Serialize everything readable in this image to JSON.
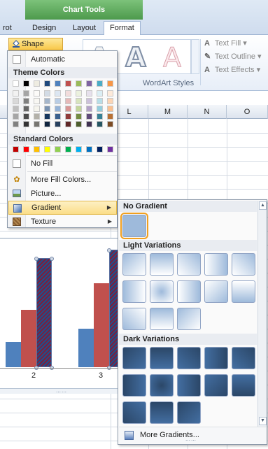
{
  "ribbon": {
    "context_title": "Chart Tools",
    "tabs": [
      "rot",
      "Design",
      "Layout",
      "Format"
    ],
    "active_tab": "Format",
    "shape_fill_label": "Shape Fill",
    "wordart_letter": "A",
    "text_fill_label": "Text Fill",
    "text_outline_label": "Text Outline",
    "text_effects_label": "Text Effects",
    "wordart_group_label": "WordArt Styles"
  },
  "grid": {
    "column_headers": [
      "L",
      "M",
      "N",
      "O"
    ]
  },
  "chart": {
    "x_labels": [
      "2",
      "3"
    ]
  },
  "chart_data": {
    "type": "bar",
    "categories": [
      "2",
      "3"
    ],
    "series": [
      {
        "color": "#4f81bd",
        "values": [
          1.5,
          2.3
        ]
      },
      {
        "color": "#c0504d",
        "values": [
          3.4,
          5.0
        ]
      },
      {
        "color": "#7a1f3d",
        "values": [
          6.5,
          7.0
        ]
      }
    ],
    "ylim": [
      0,
      7.5
    ]
  },
  "fill_menu": {
    "automatic_label": "Automatic",
    "theme_colors_header": "Theme Colors",
    "standard_colors_header": "Standard Colors",
    "no_fill_label": "No Fill",
    "more_colors_label": "More Fill Colors...",
    "picture_label": "Picture...",
    "gradient_label": "Gradient",
    "texture_label": "Texture",
    "theme_colors": [
      "#ffffff",
      "#000000",
      "#eeece1",
      "#1f497d",
      "#4f81bd",
      "#c0504d",
      "#9bbb59",
      "#8064a2",
      "#4bacc6",
      "#f79646"
    ],
    "standard_colors": [
      "#c00000",
      "#ff0000",
      "#ffc000",
      "#ffff00",
      "#92d050",
      "#00b050",
      "#00b0f0",
      "#0070c0",
      "#002060",
      "#7030a0"
    ]
  },
  "gradient_menu": {
    "no_gradient_header": "No Gradient",
    "light_header": "Light Variations",
    "dark_header": "Dark Variations",
    "more_label": "More Gradients...",
    "base_color": "#4f81bd"
  }
}
